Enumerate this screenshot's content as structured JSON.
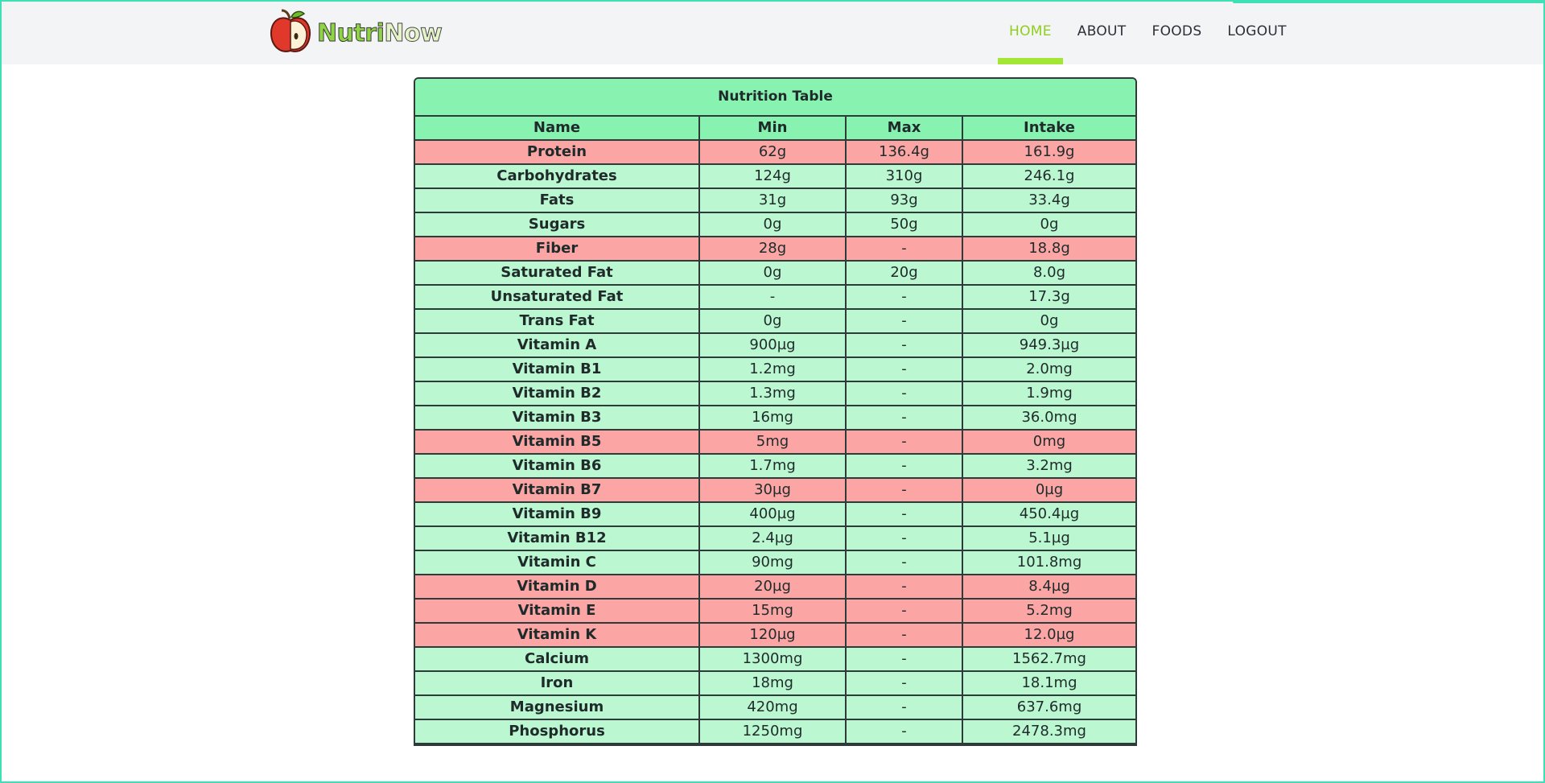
{
  "navbar": {
    "brand": {
      "part1": "Nutri",
      "part2": "Now",
      "logo_icon": "apple-icon"
    },
    "links": [
      {
        "label": "HOME",
        "active": true
      },
      {
        "label": "ABOUT",
        "active": false
      },
      {
        "label": "FOODS",
        "active": false
      },
      {
        "label": "LOGOUT",
        "active": false
      }
    ]
  },
  "colors": {
    "accent": "#a3e635",
    "header_green": "#88f2b0",
    "ok_row": "#bbf7d0",
    "warn_row": "#fca5a5",
    "frame": "#3fe0b6"
  },
  "table": {
    "title": "Nutrition Table",
    "headers": [
      "Name",
      "Min",
      "Max",
      "Intake"
    ],
    "rows": [
      {
        "name": "Protein",
        "min": "62g",
        "max": "136.4g",
        "intake": "161.9g",
        "status": "warn"
      },
      {
        "name": "Carbohydrates",
        "min": "124g",
        "max": "310g",
        "intake": "246.1g",
        "status": "ok"
      },
      {
        "name": "Fats",
        "min": "31g",
        "max": "93g",
        "intake": "33.4g",
        "status": "ok"
      },
      {
        "name": "Sugars",
        "min": "0g",
        "max": "50g",
        "intake": "0g",
        "status": "ok"
      },
      {
        "name": "Fiber",
        "min": "28g",
        "max": "-",
        "intake": "18.8g",
        "status": "warn"
      },
      {
        "name": "Saturated Fat",
        "min": "0g",
        "max": "20g",
        "intake": "8.0g",
        "status": "ok"
      },
      {
        "name": "Unsaturated Fat",
        "min": "-",
        "max": "-",
        "intake": "17.3g",
        "status": "ok"
      },
      {
        "name": "Trans Fat",
        "min": "0g",
        "max": "-",
        "intake": "0g",
        "status": "ok"
      },
      {
        "name": "Vitamin A",
        "min": "900µg",
        "max": "-",
        "intake": "949.3µg",
        "status": "ok"
      },
      {
        "name": "Vitamin B1",
        "min": "1.2mg",
        "max": "-",
        "intake": "2.0mg",
        "status": "ok"
      },
      {
        "name": "Vitamin B2",
        "min": "1.3mg",
        "max": "-",
        "intake": "1.9mg",
        "status": "ok"
      },
      {
        "name": "Vitamin B3",
        "min": "16mg",
        "max": "-",
        "intake": "36.0mg",
        "status": "ok"
      },
      {
        "name": "Vitamin B5",
        "min": "5mg",
        "max": "-",
        "intake": "0mg",
        "status": "warn"
      },
      {
        "name": "Vitamin B6",
        "min": "1.7mg",
        "max": "-",
        "intake": "3.2mg",
        "status": "ok"
      },
      {
        "name": "Vitamin B7",
        "min": "30µg",
        "max": "-",
        "intake": "0µg",
        "status": "warn"
      },
      {
        "name": "Vitamin B9",
        "min": "400µg",
        "max": "-",
        "intake": "450.4µg",
        "status": "ok"
      },
      {
        "name": "Vitamin B12",
        "min": "2.4µg",
        "max": "-",
        "intake": "5.1µg",
        "status": "ok"
      },
      {
        "name": "Vitamin C",
        "min": "90mg",
        "max": "-",
        "intake": "101.8mg",
        "status": "ok"
      },
      {
        "name": "Vitamin D",
        "min": "20µg",
        "max": "-",
        "intake": "8.4µg",
        "status": "warn"
      },
      {
        "name": "Vitamin E",
        "min": "15mg",
        "max": "-",
        "intake": "5.2mg",
        "status": "warn"
      },
      {
        "name": "Vitamin K",
        "min": "120µg",
        "max": "-",
        "intake": "12.0µg",
        "status": "warn"
      },
      {
        "name": "Calcium",
        "min": "1300mg",
        "max": "-",
        "intake": "1562.7mg",
        "status": "ok"
      },
      {
        "name": "Iron",
        "min": "18mg",
        "max": "-",
        "intake": "18.1mg",
        "status": "ok"
      },
      {
        "name": "Magnesium",
        "min": "420mg",
        "max": "-",
        "intake": "637.6mg",
        "status": "ok"
      },
      {
        "name": "Phosphorus",
        "min": "1250mg",
        "max": "-",
        "intake": "2478.3mg",
        "status": "ok"
      }
    ]
  }
}
